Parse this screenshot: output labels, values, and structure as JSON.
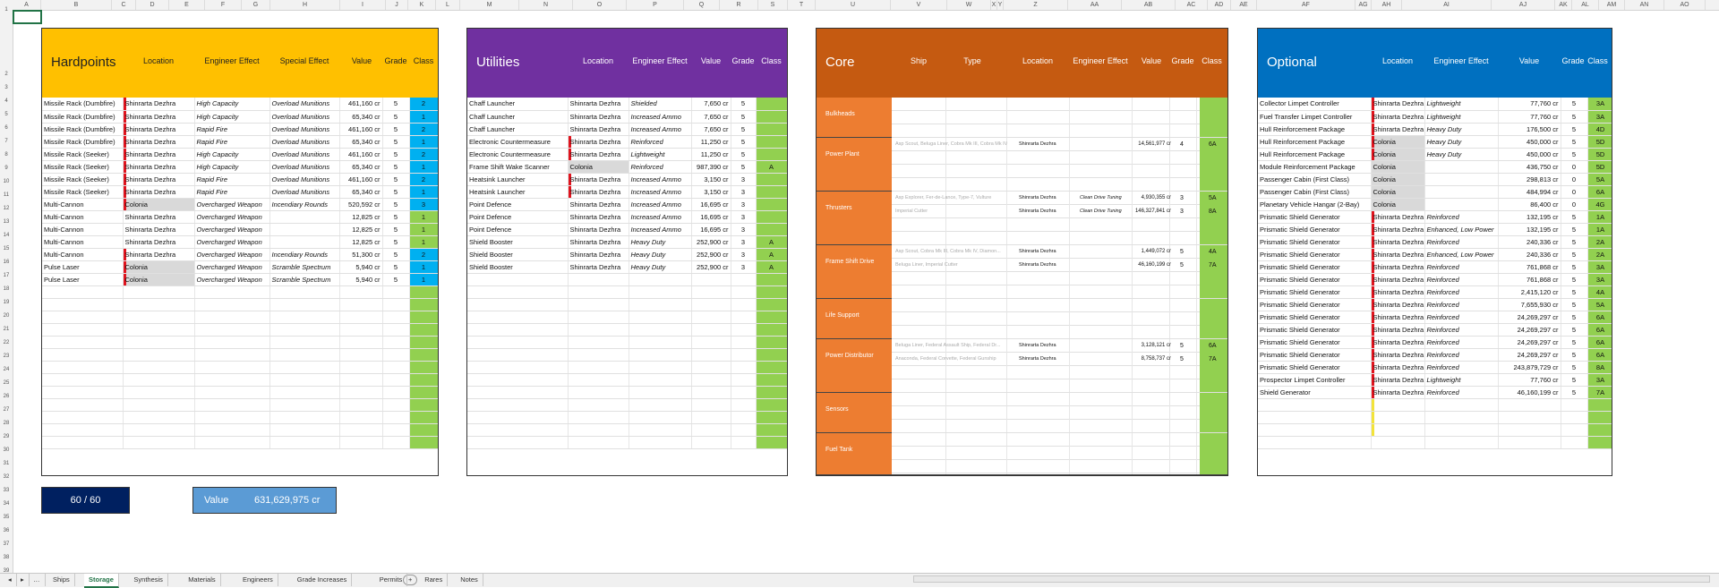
{
  "column_letters": [
    "A",
    "B",
    "C",
    "D",
    "E",
    "F",
    "G",
    "H",
    "I",
    "J",
    "K",
    "L",
    "M",
    "N",
    "O",
    "P",
    "Q",
    "R",
    "S",
    "T",
    "U",
    "V",
    "W",
    "X",
    "Y",
    "Z",
    "AA",
    "AB",
    "AC",
    "AD",
    "AE",
    "AF",
    "AG",
    "AH",
    "AI",
    "AJ",
    "AK",
    "AL",
    "AM",
    "AN",
    "AO"
  ],
  "row_numbers": [
    "1",
    "2",
    "3",
    "4",
    "5",
    "6",
    "7",
    "8",
    "9",
    "10",
    "11",
    "12",
    "13",
    "14",
    "15",
    "16",
    "17",
    "18",
    "19",
    "20",
    "21",
    "22",
    "23",
    "24",
    "25",
    "26",
    "27",
    "28",
    "29",
    "30",
    "31",
    "32",
    "33",
    "34",
    "35",
    "36",
    "37",
    "38",
    "39"
  ],
  "hardpoints": {
    "title": "Hardpoints",
    "color": "#FFC000",
    "headers": {
      "location": "Location",
      "effect": "Engineer Effect",
      "special": "Special Effect",
      "value": "Value",
      "grade": "Grade",
      "class": "Class"
    },
    "rows": [
      {
        "name": "Missile Rack (Dumbfire)",
        "loc": "Shinrarta Dezhra",
        "eff": "High Capacity",
        "special": "Overload Munitions",
        "value": "461,160 cr",
        "grade": "5",
        "cls": "2",
        "red": true,
        "gray": false,
        "ccol": "blue"
      },
      {
        "name": "Missile Rack (Dumbfire)",
        "loc": "Shinrarta Dezhra",
        "eff": "High Capacity",
        "special": "Overload Munitions",
        "value": "65,340 cr",
        "grade": "5",
        "cls": "1",
        "red": true,
        "gray": false,
        "ccol": "blue"
      },
      {
        "name": "Missile Rack (Dumbfire)",
        "loc": "Shinrarta Dezhra",
        "eff": "Rapid Fire",
        "special": "Overload Munitions",
        "value": "461,160 cr",
        "grade": "5",
        "cls": "2",
        "red": true,
        "gray": false,
        "ccol": "blue"
      },
      {
        "name": "Missile Rack (Dumbfire)",
        "loc": "Shinrarta Dezhra",
        "eff": "Rapid Fire",
        "special": "Overload Munitions",
        "value": "65,340 cr",
        "grade": "5",
        "cls": "1",
        "red": true,
        "gray": false,
        "ccol": "blue"
      },
      {
        "name": "Missile Rack (Seeker)",
        "loc": "Shinrarta Dezhra",
        "eff": "High Capacity",
        "special": "Overload Munitions",
        "value": "461,160 cr",
        "grade": "5",
        "cls": "2",
        "red": true,
        "gray": false,
        "ccol": "blue"
      },
      {
        "name": "Missile Rack (Seeker)",
        "loc": "Shinrarta Dezhra",
        "eff": "High Capacity",
        "special": "Overload Munitions",
        "value": "65,340 cr",
        "grade": "5",
        "cls": "1",
        "red": true,
        "gray": false,
        "ccol": "blue"
      },
      {
        "name": "Missile Rack (Seeker)",
        "loc": "Shinrarta Dezhra",
        "eff": "Rapid Fire",
        "special": "Overload Munitions",
        "value": "461,160 cr",
        "grade": "5",
        "cls": "2",
        "red": true,
        "gray": false,
        "ccol": "blue"
      },
      {
        "name": "Missile Rack (Seeker)",
        "loc": "Shinrarta Dezhra",
        "eff": "Rapid Fire",
        "special": "Overload Munitions",
        "value": "65,340 cr",
        "grade": "5",
        "cls": "1",
        "red": true,
        "gray": false,
        "ccol": "blue"
      },
      {
        "name": "Multi-Cannon",
        "loc": "Colonia",
        "eff": "Overcharged Weapon",
        "special": "Incendiary Rounds",
        "value": "520,592 cr",
        "grade": "5",
        "cls": "3",
        "red": true,
        "gray": true,
        "ccol": "blue"
      },
      {
        "name": "Multi-Cannon",
        "loc": "Shinrarta Dezhra",
        "eff": "Overcharged Weapon",
        "special": "",
        "value": "12,825 cr",
        "grade": "5",
        "cls": "1",
        "red": false,
        "gray": false,
        "ccol": "green"
      },
      {
        "name": "Multi-Cannon",
        "loc": "Shinrarta Dezhra",
        "eff": "Overcharged Weapon",
        "special": "",
        "value": "12,825 cr",
        "grade": "5",
        "cls": "1",
        "red": false,
        "gray": false,
        "ccol": "green"
      },
      {
        "name": "Multi-Cannon",
        "loc": "Shinrarta Dezhra",
        "eff": "Overcharged Weapon",
        "special": "",
        "value": "12,825 cr",
        "grade": "5",
        "cls": "1",
        "red": false,
        "gray": false,
        "ccol": "green"
      },
      {
        "name": "Multi-Cannon",
        "loc": "Shinrarta Dezhra",
        "eff": "Overcharged Weapon",
        "special": "Incendiary Rounds",
        "value": "51,300 cr",
        "grade": "5",
        "cls": "2",
        "red": true,
        "gray": false,
        "ccol": "blue"
      },
      {
        "name": "Pulse Laser",
        "loc": "Colonia",
        "eff": "Overcharged Weapon",
        "special": "Scramble Spectrum",
        "value": "5,940 cr",
        "grade": "5",
        "cls": "1",
        "red": true,
        "gray": true,
        "ccol": "blue"
      },
      {
        "name": "Pulse Laser",
        "loc": "Colonia",
        "eff": "Overcharged Weapon",
        "special": "Scramble Spectrum",
        "value": "5,940 cr",
        "grade": "5",
        "cls": "1",
        "red": true,
        "gray": true,
        "ccol": "blue"
      }
    ]
  },
  "utilities": {
    "title": "Utilities",
    "color": "#7030A0",
    "headers": {
      "location": "Location",
      "effect": "Engineer Effect",
      "value": "Value",
      "grade": "Grade",
      "class": "Class"
    },
    "rows": [
      {
        "name": "Chaff Launcher",
        "loc": "Shinrarta Dezhra",
        "eff": "Shielded",
        "value": "7,650 cr",
        "grade": "5",
        "cls": "",
        "red": false,
        "gray": false
      },
      {
        "name": "Chaff Launcher",
        "loc": "Shinrarta Dezhra",
        "eff": "Increased Ammo",
        "value": "7,650 cr",
        "grade": "5",
        "cls": "",
        "red": false,
        "gray": false
      },
      {
        "name": "Chaff Launcher",
        "loc": "Shinrarta Dezhra",
        "eff": "Increased Ammo",
        "value": "7,650 cr",
        "grade": "5",
        "cls": "",
        "red": false,
        "gray": false
      },
      {
        "name": "Electronic Countermeasure",
        "loc": "Shinrarta Dezhra",
        "eff": "Reinforced",
        "value": "11,250 cr",
        "grade": "5",
        "cls": "",
        "red": true,
        "gray": false
      },
      {
        "name": "Electronic Countermeasure",
        "loc": "Shinrarta Dezhra",
        "eff": "Lightweight",
        "value": "11,250 cr",
        "grade": "5",
        "cls": "",
        "red": true,
        "gray": false
      },
      {
        "name": "Frame Shift Wake Scanner",
        "loc": "Colonia",
        "eff": "Reinforced",
        "value": "987,390 cr",
        "grade": "5",
        "cls": "A",
        "red": false,
        "gray": true
      },
      {
        "name": "Heatsink Launcher",
        "loc": "Shinrarta Dezhra",
        "eff": "Increased Ammo",
        "value": "3,150 cr",
        "grade": "3",
        "cls": "",
        "red": true,
        "gray": false
      },
      {
        "name": "Heatsink Launcher",
        "loc": "Shinrarta Dezhra",
        "eff": "Increased Ammo",
        "value": "3,150 cr",
        "grade": "3",
        "cls": "",
        "red": true,
        "gray": false
      },
      {
        "name": "Point Defence",
        "loc": "Shinrarta Dezhra",
        "eff": "Increased Ammo",
        "value": "16,695 cr",
        "grade": "3",
        "cls": "",
        "red": false,
        "gray": false
      },
      {
        "name": "Point Defence",
        "loc": "Shinrarta Dezhra",
        "eff": "Increased Ammo",
        "value": "16,695 cr",
        "grade": "3",
        "cls": "",
        "red": false,
        "gray": false
      },
      {
        "name": "Point Defence",
        "loc": "Shinrarta Dezhra",
        "eff": "Increased Ammo",
        "value": "16,695 cr",
        "grade": "3",
        "cls": "",
        "red": false,
        "gray": false
      },
      {
        "name": "Shield Booster",
        "loc": "Shinrarta Dezhra",
        "eff": "Heavy Duty",
        "value": "252,900 cr",
        "grade": "3",
        "cls": "A",
        "red": false,
        "gray": false
      },
      {
        "name": "Shield Booster",
        "loc": "Shinrarta Dezhra",
        "eff": "Heavy Duty",
        "value": "252,900 cr",
        "grade": "3",
        "cls": "A",
        "red": false,
        "gray": false
      },
      {
        "name": "Shield Booster",
        "loc": "Shinrarta Dezhra",
        "eff": "Heavy Duty",
        "value": "252,900 cr",
        "grade": "3",
        "cls": "A",
        "red": false,
        "gray": false
      }
    ]
  },
  "core": {
    "title": "Core",
    "color": "#C55A11",
    "cat_color": "#ED7D31",
    "headers": {
      "ship": "Ship",
      "type": "Type",
      "location": "Location",
      "effect": "Engineer Effect",
      "value": "Value",
      "grade": "Grade",
      "class": "Class"
    },
    "categories": [
      {
        "name": "Bulkheads",
        "lines": []
      },
      {
        "name": "Power Plant",
        "lines": [
          {
            "ships": "Asp Scout, Beluga Liner, Cobra Mk III, Cobra Mk IV...",
            "loc": "Shinrarta Dezhra",
            "eff": "",
            "value": "14,561,977 cr",
            "grade": "4",
            "cls": "6A"
          }
        ]
      },
      {
        "name": "Thrusters",
        "lines": [
          {
            "ships": "Asp Explorer, Fer-de-Lance, Type-7, Vulture",
            "loc": "Shinrarta Dezhra",
            "eff": "Clean Drive Tuning",
            "value": "4,930,355 cr",
            "grade": "3",
            "cls": "5A"
          },
          {
            "ships": "Imperial Cutter",
            "loc": "Shinrarta Dezhra",
            "eff": "Clean Drive Tuning",
            "value": "146,327,841 cr",
            "grade": "3",
            "cls": "8A"
          }
        ]
      },
      {
        "name": "Frame Shift Drive",
        "lines": [
          {
            "ships": "Asp Scout, Cobra Mk III, Cobra Mk IV, Diamon...",
            "loc": "Shinrarta Dezhra",
            "eff": "",
            "value": "1,449,072 cr",
            "grade": "5",
            "cls": "4A"
          },
          {
            "ships": "Beluga Liner, Imperial Cutter",
            "loc": "Shinrarta Dezhra",
            "eff": "",
            "value": "46,160,199 cr",
            "grade": "5",
            "cls": "7A"
          }
        ]
      },
      {
        "name": "Life Support",
        "lines": []
      },
      {
        "name": "Power Distributor",
        "lines": [
          {
            "ships": "Beluga Liner, Federal Assault Ship, Federal Dr...",
            "loc": "Shinrarta Dezhra",
            "eff": "",
            "value": "3,128,121 cr",
            "grade": "5",
            "cls": "6A"
          },
          {
            "ships": "Anaconda, Federal Corvette, Federal Gunship",
            "loc": "Shinrarta Dezhra",
            "eff": "",
            "value": "8,758,737 cr",
            "grade": "5",
            "cls": "7A"
          }
        ]
      },
      {
        "name": "Sensors",
        "lines": []
      },
      {
        "name": "Fuel Tank",
        "lines": []
      }
    ]
  },
  "optional": {
    "title": "Optional",
    "color": "#0070C0",
    "headers": {
      "location": "Location",
      "effect": "Engineer Effect",
      "value": "Value",
      "grade": "Grade",
      "class": "Class"
    },
    "rows": [
      {
        "name": "Collector Limpet Controller",
        "loc": "Shinrarta Dezhra",
        "eff": "Lightweight",
        "value": "77,760 cr",
        "grade": "5",
        "cls": "3A",
        "bar": "red",
        "gray": false
      },
      {
        "name": "Fuel Transfer Limpet Controller",
        "loc": "Shinrarta Dezhra",
        "eff": "Lightweight",
        "value": "77,760 cr",
        "grade": "5",
        "cls": "3A",
        "bar": "red",
        "gray": false
      },
      {
        "name": "Hull Reinforcement Package",
        "loc": "Shinrarta Dezhra",
        "eff": "Heavy Duty",
        "value": "176,500 cr",
        "grade": "5",
        "cls": "4D",
        "bar": "red",
        "gray": false
      },
      {
        "name": "Hull Reinforcement Package",
        "loc": "Colonia",
        "eff": "Heavy Duty",
        "value": "450,000 cr",
        "grade": "5",
        "cls": "5D",
        "bar": "red",
        "gray": true
      },
      {
        "name": "Hull Reinforcement Package",
        "loc": "Colonia",
        "eff": "Heavy Duty",
        "value": "450,000 cr",
        "grade": "5",
        "cls": "5D",
        "bar": "red",
        "gray": true
      },
      {
        "name": "Module Reinforcement Package",
        "loc": "Colonia",
        "eff": "",
        "value": "436,750 cr",
        "grade": "0",
        "cls": "5D",
        "bar": "",
        "gray": true
      },
      {
        "name": "Passenger Cabin (First Class)",
        "loc": "Colonia",
        "eff": "",
        "value": "298,813 cr",
        "grade": "0",
        "cls": "5A",
        "bar": "",
        "gray": true
      },
      {
        "name": "Passenger Cabin (First Class)",
        "loc": "Colonia",
        "eff": "",
        "value": "484,994 cr",
        "grade": "0",
        "cls": "6A",
        "bar": "",
        "gray": true
      },
      {
        "name": "Planetary Vehicle Hangar (2-Bay)",
        "loc": "Colonia",
        "eff": "",
        "value": "86,400 cr",
        "grade": "0",
        "cls": "4G",
        "bar": "",
        "gray": true
      },
      {
        "name": "Prismatic Shield Generator",
        "loc": "Shinrarta Dezhra",
        "eff": "Reinforced",
        "value": "132,195 cr",
        "grade": "5",
        "cls": "1A",
        "bar": "red",
        "gray": false
      },
      {
        "name": "Prismatic Shield Generator",
        "loc": "Shinrarta Dezhra",
        "eff": "Enhanced, Low Power",
        "value": "132,195 cr",
        "grade": "5",
        "cls": "1A",
        "bar": "red",
        "gray": false
      },
      {
        "name": "Prismatic Shield Generator",
        "loc": "Shinrarta Dezhra",
        "eff": "Reinforced",
        "value": "240,336 cr",
        "grade": "5",
        "cls": "2A",
        "bar": "red",
        "gray": false
      },
      {
        "name": "Prismatic Shield Generator",
        "loc": "Shinrarta Dezhra",
        "eff": "Enhanced, Low Power",
        "value": "240,336 cr",
        "grade": "5",
        "cls": "2A",
        "bar": "red",
        "gray": false
      },
      {
        "name": "Prismatic Shield Generator",
        "loc": "Shinrarta Dezhra",
        "eff": "Reinforced",
        "value": "761,868 cr",
        "grade": "5",
        "cls": "3A",
        "bar": "red",
        "gray": false
      },
      {
        "name": "Prismatic Shield Generator",
        "loc": "Shinrarta Dezhra",
        "eff": "Reinforced",
        "value": "761,868 cr",
        "grade": "5",
        "cls": "3A",
        "bar": "red",
        "gray": false
      },
      {
        "name": "Prismatic Shield Generator",
        "loc": "Shinrarta Dezhra",
        "eff": "Reinforced",
        "value": "2,415,120 cr",
        "grade": "5",
        "cls": "4A",
        "bar": "red",
        "gray": false
      },
      {
        "name": "Prismatic Shield Generator",
        "loc": "Shinrarta Dezhra",
        "eff": "Reinforced",
        "value": "7,655,930 cr",
        "grade": "5",
        "cls": "5A",
        "bar": "red",
        "gray": false
      },
      {
        "name": "Prismatic Shield Generator",
        "loc": "Shinrarta Dezhra",
        "eff": "Reinforced",
        "value": "24,269,297 cr",
        "grade": "5",
        "cls": "6A",
        "bar": "red",
        "gray": false
      },
      {
        "name": "Prismatic Shield Generator",
        "loc": "Shinrarta Dezhra",
        "eff": "Reinforced",
        "value": "24,269,297 cr",
        "grade": "5",
        "cls": "6A",
        "bar": "red",
        "gray": false
      },
      {
        "name": "Prismatic Shield Generator",
        "loc": "Shinrarta Dezhra",
        "eff": "Reinforced",
        "value": "24,269,297 cr",
        "grade": "5",
        "cls": "6A",
        "bar": "red",
        "gray": false
      },
      {
        "name": "Prismatic Shield Generator",
        "loc": "Shinrarta Dezhra",
        "eff": "Reinforced",
        "value": "24,269,297 cr",
        "grade": "5",
        "cls": "6A",
        "bar": "red",
        "gray": false
      },
      {
        "name": "Prismatic Shield Generator",
        "loc": "Shinrarta Dezhra",
        "eff": "Reinforced",
        "value": "243,879,729 cr",
        "grade": "5",
        "cls": "8A",
        "bar": "red",
        "gray": false
      },
      {
        "name": "Prospector Limpet Controller",
        "loc": "Shinrarta Dezhra",
        "eff": "Lightweight",
        "value": "77,760 cr",
        "grade": "5",
        "cls": "3A",
        "bar": "red",
        "gray": false
      },
      {
        "name": "Shield Generator",
        "loc": "Shinrarta Dezhra",
        "eff": "Reinforced",
        "value": "46,160,199 cr",
        "grade": "5",
        "cls": "7A",
        "bar": "red",
        "gray": false
      },
      {
        "name": "",
        "loc": "",
        "eff": "",
        "value": "",
        "grade": "",
        "cls": "",
        "bar": "yellow",
        "gray": false
      },
      {
        "name": "",
        "loc": "",
        "eff": "",
        "value": "",
        "grade": "",
        "cls": "",
        "bar": "yellow",
        "gray": false
      },
      {
        "name": "",
        "loc": "",
        "eff": "",
        "value": "",
        "grade": "",
        "cls": "",
        "bar": "yellow",
        "gray": false
      }
    ]
  },
  "summary": {
    "count": "60 / 60",
    "value_label": "Value",
    "value": "631,629,975 cr"
  },
  "sheet_tabs": [
    "Ships",
    "Storage",
    "Synthesis",
    "Materials",
    "Engineers",
    "Grade Increases",
    "Permits",
    "Rares",
    "Notes"
  ],
  "active_tab": "Storage",
  "colors": {
    "green": "#92D050",
    "blue": "#00B0F0",
    "count_bg": "#002060",
    "value_bg": "#5B9BD5",
    "red_bar": "#E0141E",
    "gray": "#D9D9D9"
  }
}
